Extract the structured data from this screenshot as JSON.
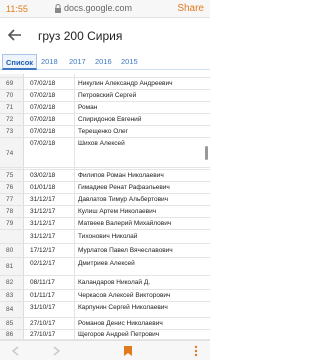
{
  "status": {
    "time": "11:55"
  },
  "browser": {
    "url": "docs.google.com",
    "share_label": "Share"
  },
  "doc": {
    "title": "груз 200 Сирия"
  },
  "tabs": [
    {
      "label": "Список",
      "active": true
    },
    {
      "label": "2018",
      "active": false
    },
    {
      "label": "2017",
      "active": false
    },
    {
      "label": "2016",
      "active": false
    },
    {
      "label": "2015",
      "active": false
    }
  ],
  "rows": [
    {
      "num": "",
      "date": "",
      "name": ""
    },
    {
      "num": "69",
      "date": "07/02/18",
      "name": "Никулин Александр Андреевич"
    },
    {
      "num": "70",
      "date": "07/02/18",
      "name": "Петровский Сергей"
    },
    {
      "num": "71",
      "date": "07/02/18",
      "name": "Роман"
    },
    {
      "num": "72",
      "date": "07/02/18",
      "name": "Спиридонов Евгений"
    },
    {
      "num": "73",
      "date": "07/02/18",
      "name": "Терещенко Олег"
    },
    {
      "num": "74",
      "date": "07/02/18",
      "name": "Шихов Алексей"
    },
    {
      "num": "",
      "date": "",
      "name": ""
    },
    {
      "num": "75",
      "date": "03/02/18",
      "name": "Филипов Роман Николаевич"
    },
    {
      "num": "76",
      "date": "01/01/18",
      "name": "Гимадиев Ренат Рафаэльевич"
    },
    {
      "num": "77",
      "date": "31/12/17",
      "name": "Давлатов Тимур Альбертович"
    },
    {
      "num": "78",
      "date": "31/12/17",
      "name": "Кулиш Артем Николаевич"
    },
    {
      "num": "79",
      "date": "31/12/17",
      "name": "Матвеев Валерий Михайлович"
    },
    {
      "num": "",
      "date": "31/12/17",
      "name": "Тихонович Николай"
    },
    {
      "num": "80",
      "date": "17/12/17",
      "name": "Мурлатов Павел Вячеславович"
    },
    {
      "num": "81",
      "date": "02/12/17",
      "name": "Дмитриев Алексей"
    },
    {
      "num": "82",
      "date": "08/11/17",
      "name": "Каландаров Николай Д."
    },
    {
      "num": "83",
      "date": "01/11/17",
      "name": "Черкасов Алексей Викторович"
    },
    {
      "num": "84",
      "date": "31/10/17",
      "name": "Карпунин Сергей Николаевич"
    },
    {
      "num": "85",
      "date": "27/10/17",
      "name": "Романов Денис Николаевич"
    },
    {
      "num": "86",
      "date": "27/10/17",
      "name": "Щегоров Андрей Петрович"
    }
  ]
}
